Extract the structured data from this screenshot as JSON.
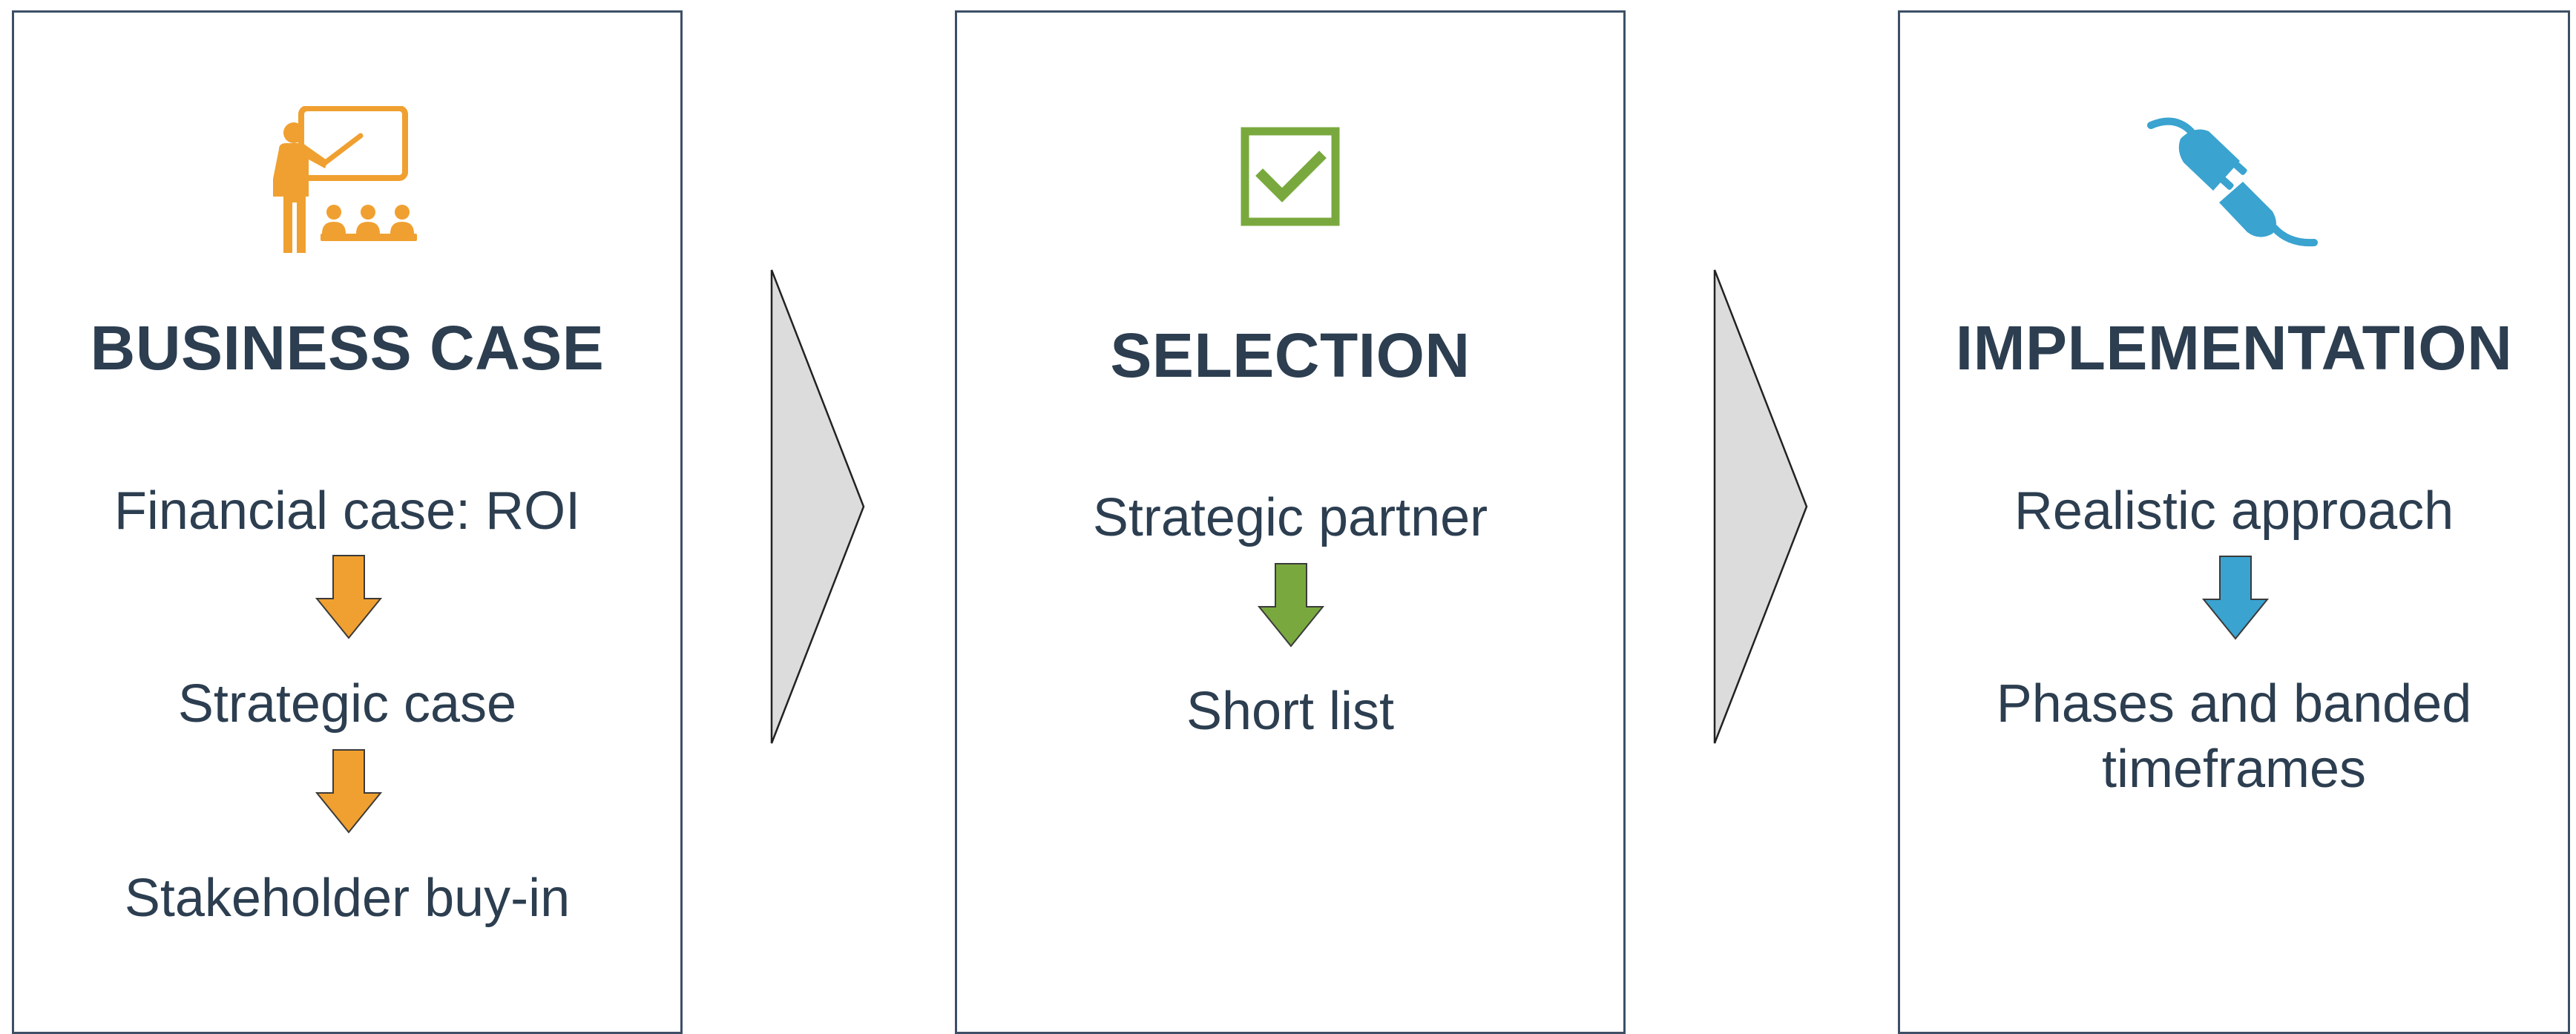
{
  "stages": [
    {
      "title": "BUSINESS CASE",
      "icon": "presentation-teacher-icon",
      "items": [
        "Financial case: ROI",
        "Strategic case",
        "Stakeholder buy-in"
      ]
    },
    {
      "title": "SELECTION",
      "icon": "checkbox-checked-icon",
      "items": [
        "Strategic partner",
        "Short list"
      ]
    },
    {
      "title": "IMPLEMENTATION",
      "icon": "plug-connect-icon",
      "items": [
        "Realistic approach",
        "Phases and banded timeframes"
      ]
    }
  ],
  "colors": {
    "business": "#f0a030",
    "selection": "#79a93e",
    "implementation": "#3aa3d0",
    "text": "#2c3e50",
    "border": "#3d4f66",
    "chevron_fill": "#dcdcdc"
  }
}
